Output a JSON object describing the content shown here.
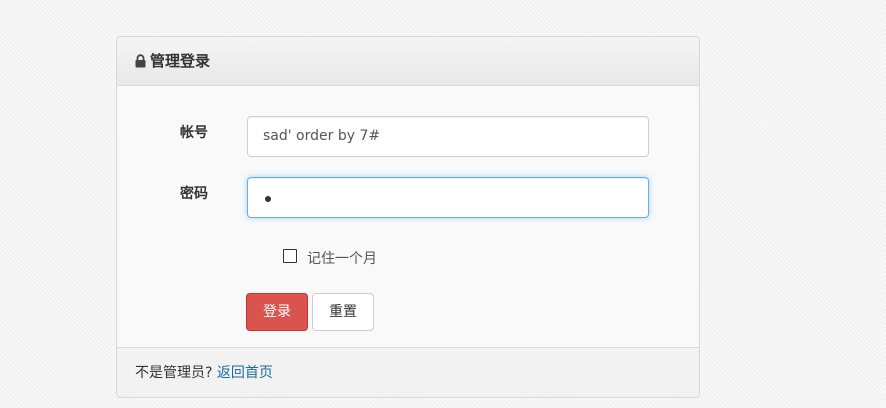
{
  "panel": {
    "title": "管理登录",
    "icon": "lock-icon"
  },
  "form": {
    "account_label": "帐号",
    "account_value": "sad' order by 7#",
    "password_label": "密码",
    "password_masked_length": 1,
    "remember_label": "记住一个月",
    "remember_checked": false,
    "login_label": "登录",
    "reset_label": "重置"
  },
  "footer": {
    "prompt": "不是管理员?",
    "link_text": "返回首页"
  },
  "colors": {
    "login_button": "#d9534f",
    "link": "#1c6b9c",
    "focus_border": "#66afe9"
  }
}
